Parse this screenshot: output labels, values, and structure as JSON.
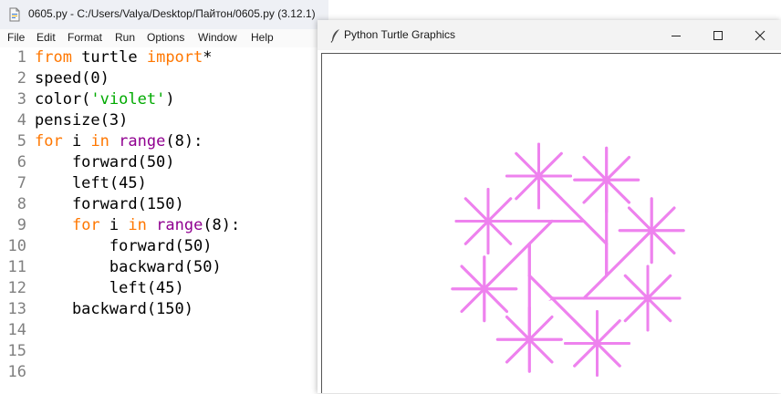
{
  "editor": {
    "title": "0605.py - C:/Users/Valya/Desktop/Пайтон/0605.py (3.12.1)",
    "menu": [
      "File",
      "Edit",
      "Format",
      "Run",
      "Options",
      "Window",
      "Help"
    ],
    "line_numbers": [
      "1",
      "2",
      "3",
      "4",
      "5",
      "6",
      "7",
      "8",
      "9",
      "10",
      "11",
      "12",
      "13",
      "14",
      "15",
      "16"
    ],
    "code_lines": [
      [
        {
          "t": "from",
          "c": "kw"
        },
        {
          "t": " turtle ",
          "c": ""
        },
        {
          "t": "import",
          "c": "kw"
        },
        {
          "t": "*",
          "c": ""
        }
      ],
      [
        {
          "t": "speed(0)",
          "c": ""
        }
      ],
      [
        {
          "t": "color(",
          "c": ""
        },
        {
          "t": "'violet'",
          "c": "str"
        },
        {
          "t": ")",
          "c": ""
        }
      ],
      [
        {
          "t": "pensize(3)",
          "c": ""
        }
      ],
      [
        {
          "t": "for",
          "c": "kw"
        },
        {
          "t": " i ",
          "c": ""
        },
        {
          "t": "in",
          "c": "kw"
        },
        {
          "t": " ",
          "c": ""
        },
        {
          "t": "range",
          "c": "bi"
        },
        {
          "t": "(8):",
          "c": ""
        }
      ],
      [
        {
          "t": "    forward(50)",
          "c": ""
        }
      ],
      [
        {
          "t": "    left(45)",
          "c": ""
        }
      ],
      [
        {
          "t": "    forward(150)",
          "c": ""
        }
      ],
      [
        {
          "t": "    ",
          "c": ""
        },
        {
          "t": "for",
          "c": "kw"
        },
        {
          "t": " i ",
          "c": ""
        },
        {
          "t": "in",
          "c": "kw"
        },
        {
          "t": " ",
          "c": ""
        },
        {
          "t": "range",
          "c": "bi"
        },
        {
          "t": "(8):",
          "c": ""
        }
      ],
      [
        {
          "t": "        forward(50)",
          "c": ""
        }
      ],
      [
        {
          "t": "        backward(50)",
          "c": ""
        }
      ],
      [
        {
          "t": "        left(45)",
          "c": ""
        }
      ],
      [
        {
          "t": "    backward(150)",
          "c": ""
        }
      ]
    ]
  },
  "turtle_window": {
    "title": "Python Turtle Graphics",
    "controls": [
      "minimize-icon",
      "maximize-icon",
      "close-icon"
    ],
    "drawing": {
      "pen_color": "#ee82ee",
      "pen_size": 3,
      "repeat": 8,
      "step": 50,
      "turn_deg": 45,
      "long_step": 150
    }
  }
}
